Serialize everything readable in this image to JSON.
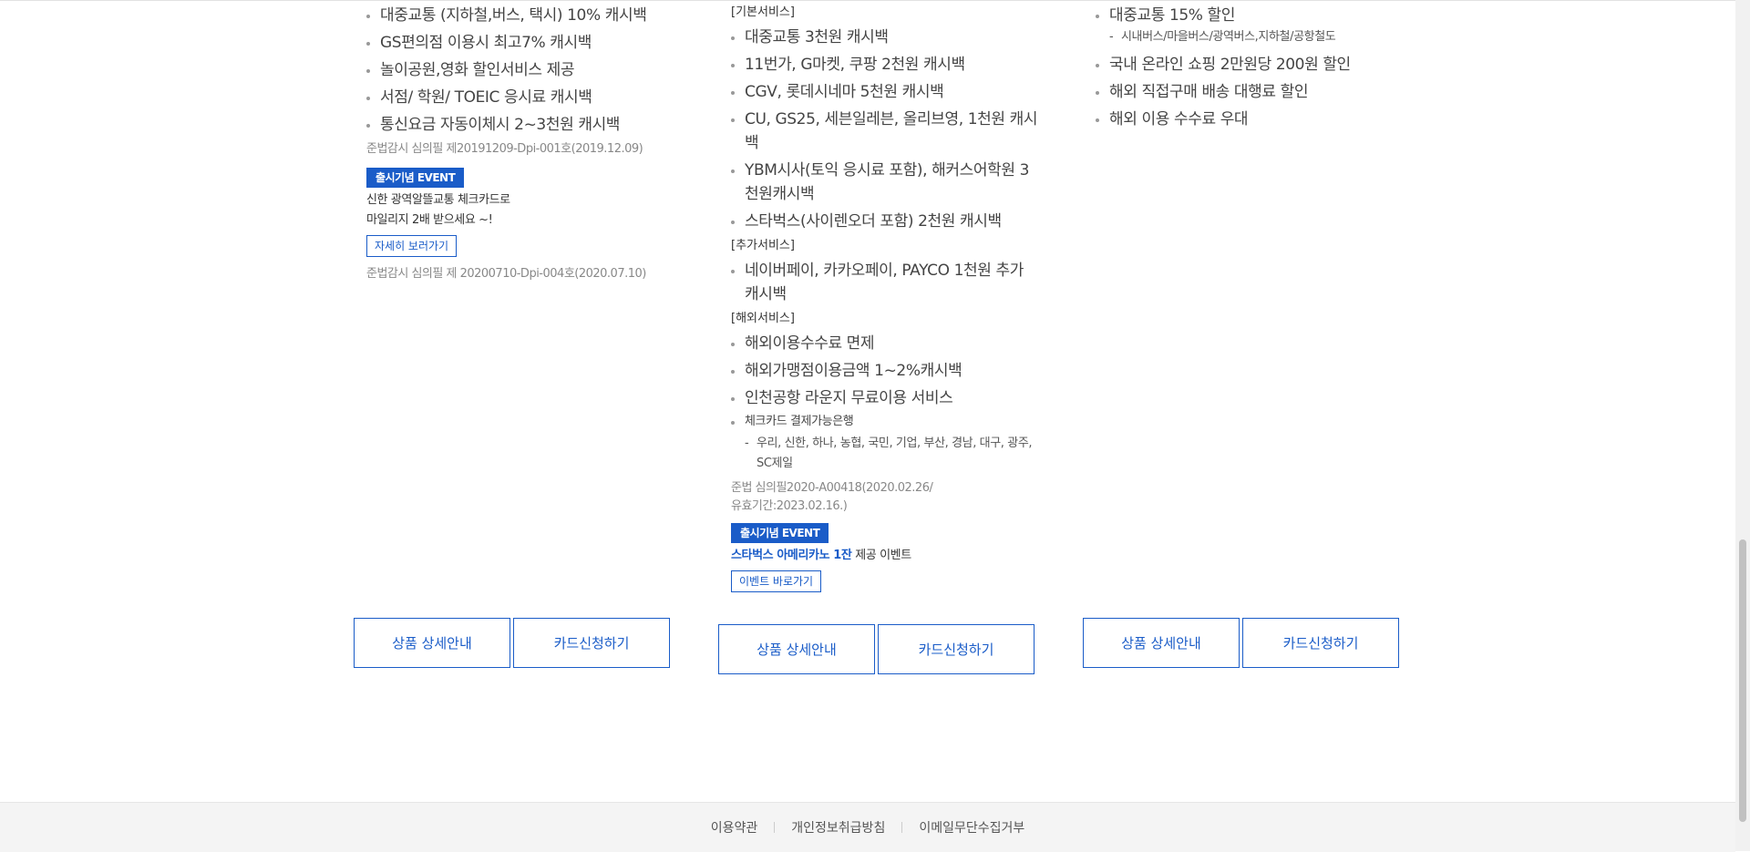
{
  "col1": {
    "benefits": [
      "대중교통 (지하철,버스, 택시) 10% 캐시백",
      "GS편의점 이용시 최고7% 캐시백",
      "놀이공원,영화 할인서비스 제공",
      "서점/ 학원/ TOEIC 응시료 캐시백",
      "통신요금 자동이체시 2~3천원 캐시백"
    ],
    "note1": "준법감시 심의필 제20191209-Dpi-001호(2019.12.09)",
    "event_badge": "출시기념 EVENT",
    "event_line1": "신한 광역알뜰교통 체크카드로",
    "event_line2": "마일리지 2배 받으세요 ~!",
    "event_link": "자세히 보러가기",
    "note2": "준법감시 심의필 제 20200710-Dpi-004호(2020.07.10)",
    "btn_detail": "상품 상세안내",
    "btn_apply": "카드신청하기"
  },
  "col2": {
    "basic_title": "[기본서비스]",
    "basic": [
      "대중교통 3천원 캐시백",
      "11번가, G마켓, 쿠팡 2천원 캐시백",
      "CGV, 롯데시네마 5천원 캐시백",
      "CU, GS25, 세븐일레븐, 올리브영, 1천원 캐시백",
      "YBM시사(토익 응시료 포함), 해커스어학원 3천원캐시백",
      "스타벅스(사이렌오더 포함) 2천원 캐시백"
    ],
    "extra_title": "[추가서비스]",
    "extra": [
      "네이버페이, 카카오페이, PAYCO 1천원 추가 캐시백"
    ],
    "overseas_title": "[해외서비스]",
    "overseas": [
      "해외이용수수료 면제",
      "해외가맹점이용금액 1~2%캐시백",
      "인천공항 라운지 무료이용 서비스"
    ],
    "bank_title": "체크카드 결제가능은행",
    "banks": "우리, 신한, 하나, 농협, 국민, 기업, 부산, 경남, 대구, 광주, SC제일",
    "note_line1": "준법 심의필2020-A00418(2020.02.26/",
    "note_line2": "유효기간:2023.02.16.)",
    "event_badge": "출시기념 EVENT",
    "event_strong": "스타벅스 아메리카노 1잔",
    "event_rest": " 제공 이벤트",
    "event_link": "이벤트 바로가기",
    "btn_detail": "상품 상세안내",
    "btn_apply": "카드신청하기"
  },
  "col3": {
    "item1": "대중교통 15% 할인",
    "item1_sub": "시내버스/마을버스/광역버스,지하철/공항철도",
    "items": [
      "국내 온라인 쇼핑 2만원당 200원 할인",
      "해외 직접구매 배송 대행료 할인",
      "해외 이용 수수료 우대"
    ],
    "btn_detail": "상품 상세안내",
    "btn_apply": "카드신청하기"
  },
  "footer": {
    "terms": "이용약관",
    "privacy": "개인정보취급방침",
    "email": "이메일무단수집거부"
  },
  "colors": {
    "accent": "#1a5cc8",
    "footer_bg": "#f4f4f4"
  }
}
